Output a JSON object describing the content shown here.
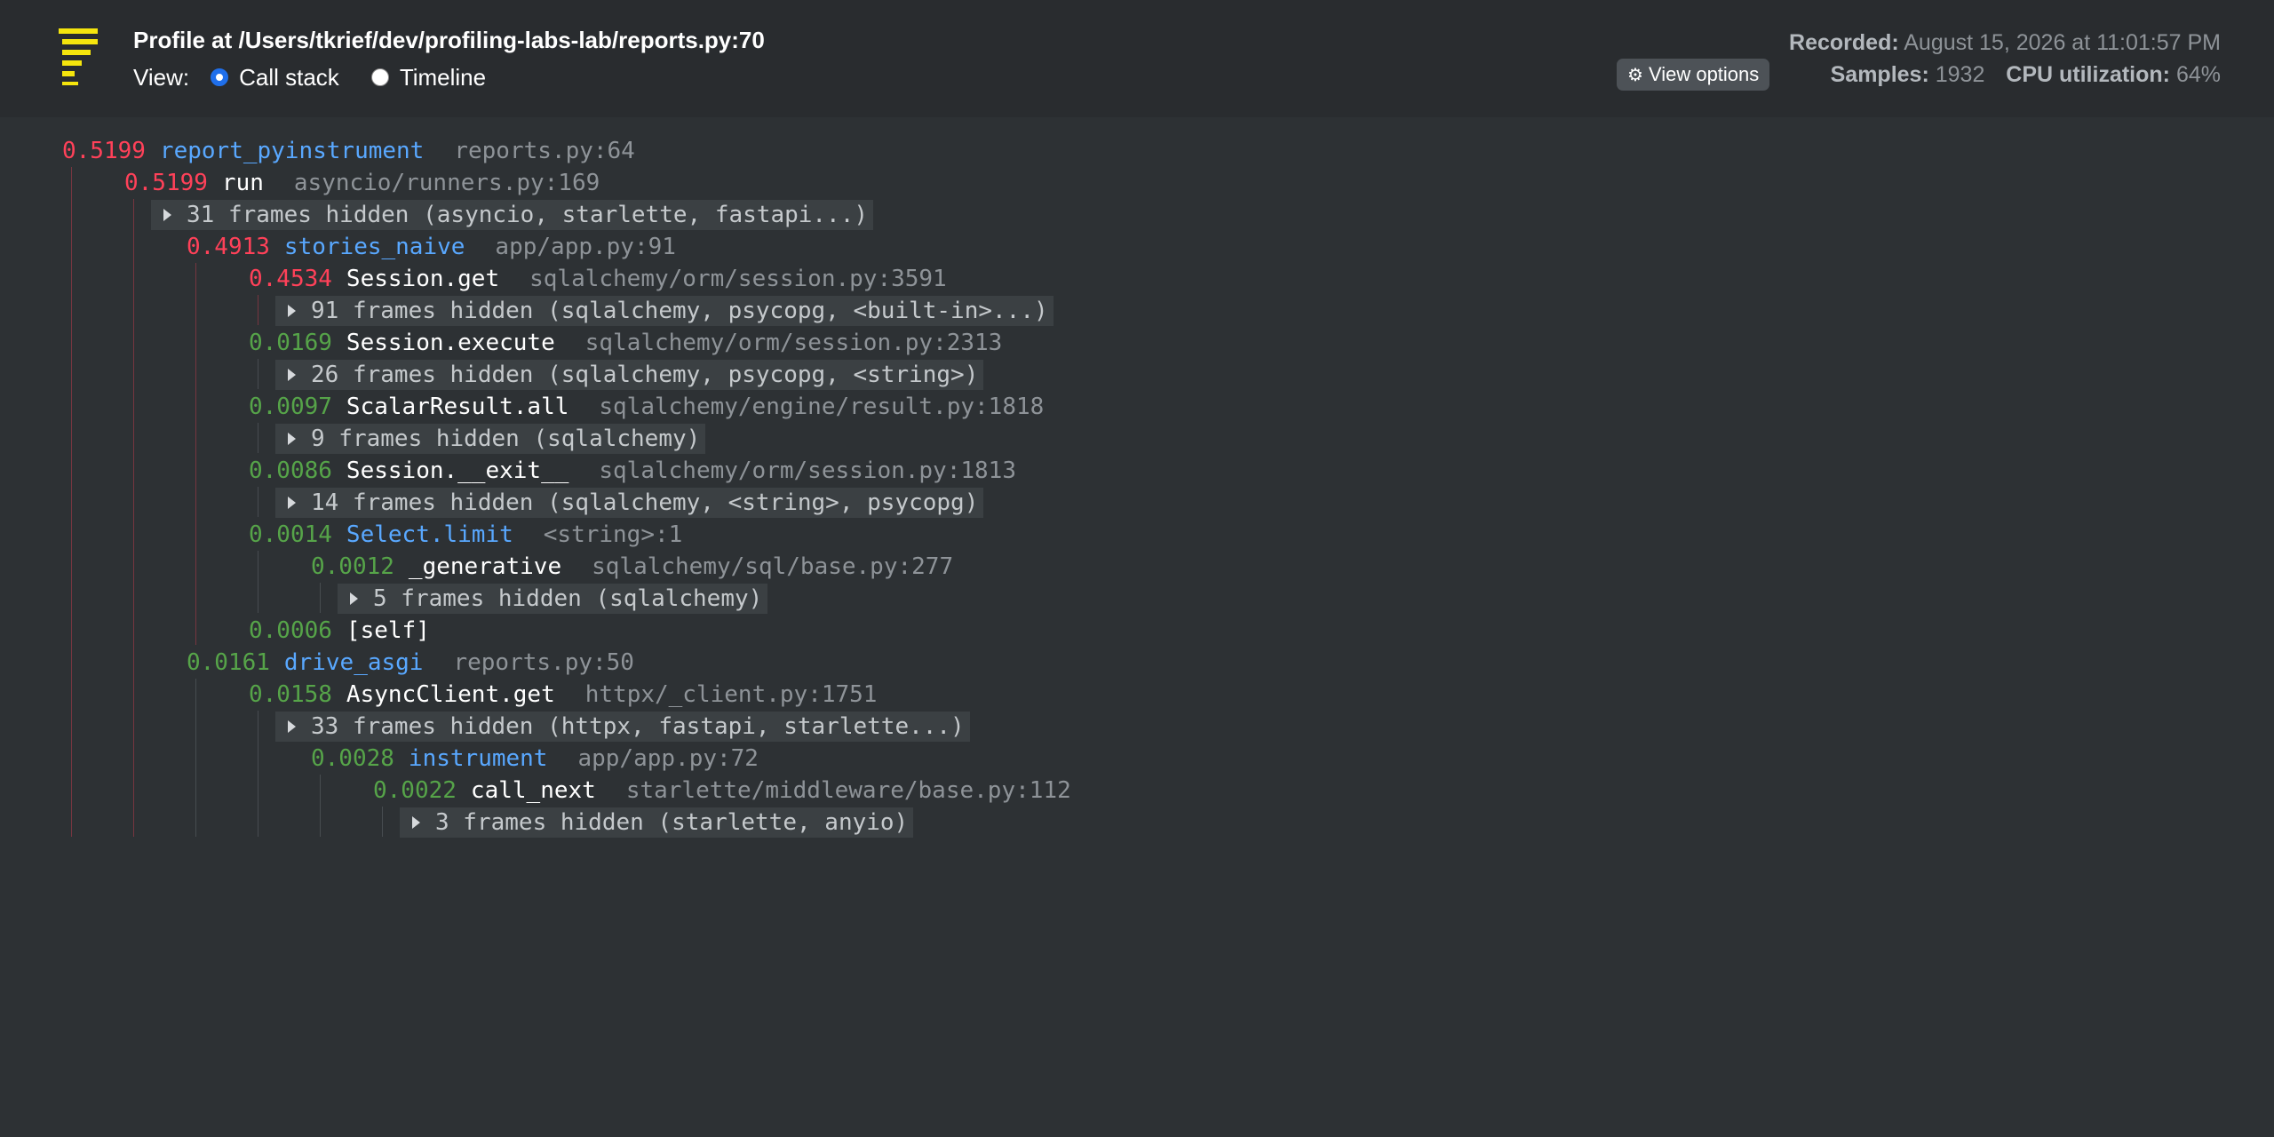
{
  "header": {
    "title": "Profile at /Users/tkrief/dev/profiling-labs-lab/reports.py:70",
    "view_label": "View:",
    "view_options": [
      {
        "label": "Call stack",
        "selected": true
      },
      {
        "label": "Timeline",
        "selected": false
      }
    ],
    "view_options_button": "View options",
    "recorded_label": "Recorded:",
    "recorded_value": "August 15, 2026 at 11:01:57 PM",
    "samples_label": "Samples:",
    "samples_value": "1932",
    "cpu_label": "CPU utilization:",
    "cpu_value": "64%"
  },
  "colors": {
    "background": "#2d3134",
    "header_background": "#292c2f",
    "time_hot": "#ff4159",
    "time_cool": "#56a449",
    "app_function": "#59a8ff",
    "library_function": "#ffffff",
    "location": "#8e9398",
    "logo": "#f5e50d"
  },
  "icons": {
    "logo": "pyinstrument-logo-icon",
    "view_options": "gear-icon",
    "hidden_frames": "caret-right-icon"
  },
  "tree": [
    {
      "kind": "frame",
      "depth": 0,
      "time": "0.5199",
      "hot": true,
      "func": "report_pyinstrument",
      "app": true,
      "location": "reports.py:64"
    },
    {
      "kind": "frame",
      "depth": 1,
      "time": "0.5199",
      "hot": true,
      "func": "run",
      "app": false,
      "location": "asyncio/runners.py:169"
    },
    {
      "kind": "group",
      "depth": 2,
      "label": "31 frames hidden (asyncio, starlette, fastapi...)"
    },
    {
      "kind": "frame",
      "depth": 2,
      "time": "0.4913",
      "hot": true,
      "func": "stories_naive",
      "app": true,
      "location": "app/app.py:91"
    },
    {
      "kind": "frame",
      "depth": 3,
      "time": "0.4534",
      "hot": true,
      "func": "Session.get",
      "app": false,
      "location": "sqlalchemy/orm/session.py:3591"
    },
    {
      "kind": "group",
      "depth": 4,
      "label": "91 frames hidden (sqlalchemy, psycopg, <built-in>...)"
    },
    {
      "kind": "frame",
      "depth": 3,
      "time": "0.0169",
      "hot": false,
      "func": "Session.execute",
      "app": false,
      "location": "sqlalchemy/orm/session.py:2313"
    },
    {
      "kind": "group",
      "depth": 4,
      "label": "26 frames hidden (sqlalchemy, psycopg, <string>)"
    },
    {
      "kind": "frame",
      "depth": 3,
      "time": "0.0097",
      "hot": false,
      "func": "ScalarResult.all",
      "app": false,
      "location": "sqlalchemy/engine/result.py:1818"
    },
    {
      "kind": "group",
      "depth": 4,
      "label": "9 frames hidden (sqlalchemy)"
    },
    {
      "kind": "frame",
      "depth": 3,
      "time": "0.0086",
      "hot": false,
      "func": "Session.__exit__",
      "app": false,
      "location": "sqlalchemy/orm/session.py:1813"
    },
    {
      "kind": "group",
      "depth": 4,
      "label": "14 frames hidden (sqlalchemy, <string>, psycopg)"
    },
    {
      "kind": "frame",
      "depth": 3,
      "time": "0.0014",
      "hot": false,
      "func": "Select.limit",
      "app": true,
      "location": "<string>:1"
    },
    {
      "kind": "frame",
      "depth": 4,
      "time": "0.0012",
      "hot": false,
      "func": "_generative",
      "app": false,
      "location": "sqlalchemy/sql/base.py:277"
    },
    {
      "kind": "group",
      "depth": 5,
      "label": "5 frames hidden (sqlalchemy)"
    },
    {
      "kind": "frame",
      "depth": 3,
      "time": "0.0006",
      "hot": false,
      "func": "[self]",
      "app": false,
      "location": ""
    },
    {
      "kind": "frame",
      "depth": 2,
      "time": "0.0161",
      "hot": false,
      "func": "drive_asgi",
      "app": true,
      "location": "reports.py:50"
    },
    {
      "kind": "frame",
      "depth": 3,
      "time": "0.0158",
      "hot": false,
      "func": "AsyncClient.get",
      "app": false,
      "location": "httpx/_client.py:1751"
    },
    {
      "kind": "group",
      "depth": 4,
      "label": "33 frames hidden (httpx, fastapi, starlette...)"
    },
    {
      "kind": "frame",
      "depth": 4,
      "time": "0.0028",
      "hot": false,
      "func": "instrument",
      "app": true,
      "location": "app/app.py:72"
    },
    {
      "kind": "frame",
      "depth": 5,
      "time": "0.0022",
      "hot": false,
      "func": "call_next",
      "app": false,
      "location": "starlette/middleware/base.py:112"
    },
    {
      "kind": "group",
      "depth": 6,
      "label": "3 frames hidden (starlette, anyio)"
    }
  ]
}
